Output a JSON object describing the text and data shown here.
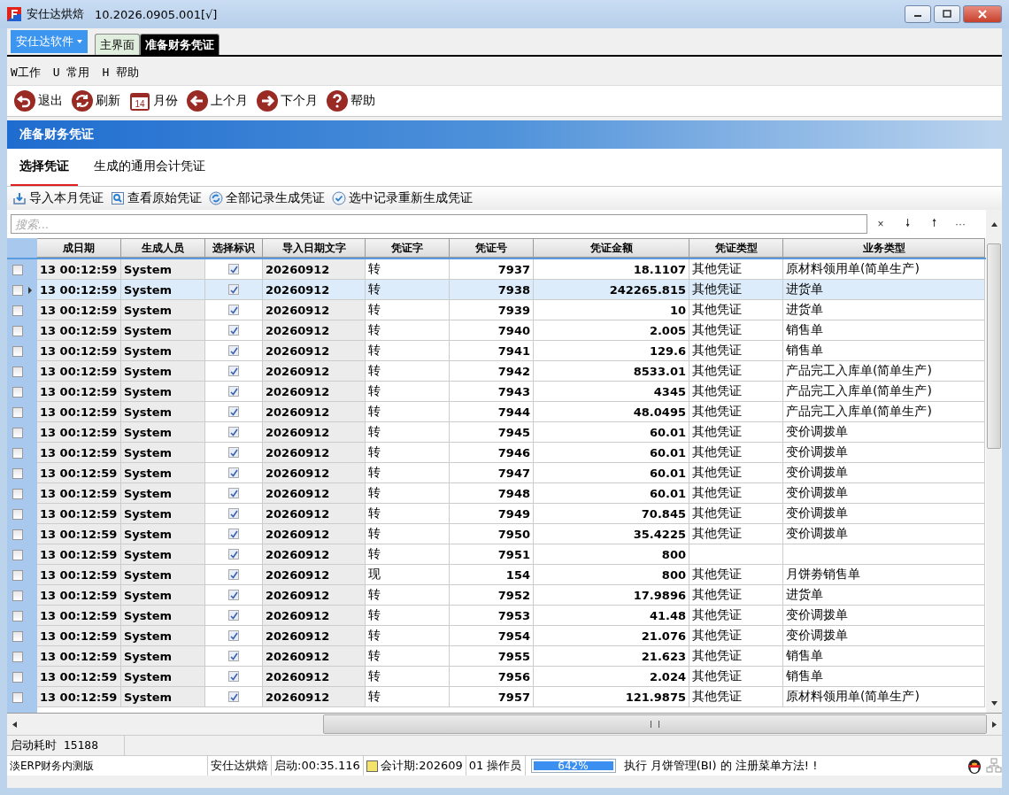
{
  "window": {
    "title": "安仕达烘焙",
    "version": "10.2026.0905.001[√]"
  },
  "app_menu": {
    "label": "安仕达软件"
  },
  "doc_tabs": [
    {
      "label": "主界面",
      "selected": false
    },
    {
      "label": "准备财务凭证",
      "selected": true
    }
  ],
  "menu": [
    "W工作",
    "U 常用",
    "H 帮助"
  ],
  "toolbar": [
    {
      "kind": "exit",
      "label": "退出"
    },
    {
      "kind": "refresh",
      "label": "刷新"
    },
    {
      "kind": "calendar",
      "label": "月份",
      "day": "14"
    },
    {
      "kind": "prev",
      "label": "上个月"
    },
    {
      "kind": "next",
      "label": "下个月"
    },
    {
      "kind": "help",
      "label": "帮助"
    }
  ],
  "panel_title": "准备财务凭证",
  "tabs": [
    {
      "label": "选择凭证",
      "selected": true
    },
    {
      "label": "生成的通用会计凭证",
      "selected": false
    }
  ],
  "actions": [
    {
      "kind": "import",
      "label": "导入本月凭证"
    },
    {
      "kind": "view",
      "label": "查看原始凭证"
    },
    {
      "kind": "cycle",
      "label": "全部记录生成凭证"
    },
    {
      "kind": "check",
      "label": "选中记录重新生成凭证"
    }
  ],
  "search": {
    "placeholder": "搜索...",
    "buttons": [
      "×",
      "🠗",
      "🠕",
      "···"
    ]
  },
  "table": {
    "columns": [
      "成日期",
      "生成人员",
      "选择标识",
      "导入日期文字",
      "凭证字",
      "凭证号",
      "凭证金额",
      "凭证类型",
      "业务类型"
    ],
    "rows": [
      {
        "checked": false,
        "selected": false,
        "date": "13 00:12:59",
        "person": "System",
        "marked": true,
        "import": "20260912",
        "char": "转",
        "no": "7937",
        "amount": "18.1107",
        "type": "其他凭证",
        "business": "原材料领用单(简单生产)"
      },
      {
        "checked": false,
        "selected": true,
        "date": "13 00:12:59",
        "person": "System",
        "marked": true,
        "import": "20260912",
        "char": "转",
        "no": "7938",
        "amount": "242265.815",
        "type": "其他凭证",
        "business": "进货单"
      },
      {
        "checked": false,
        "selected": false,
        "date": "13 00:12:59",
        "person": "System",
        "marked": true,
        "import": "20260912",
        "char": "转",
        "no": "7939",
        "amount": "10",
        "type": "其他凭证",
        "business": "进货单"
      },
      {
        "checked": false,
        "selected": false,
        "date": "13 00:12:59",
        "person": "System",
        "marked": true,
        "import": "20260912",
        "char": "转",
        "no": "7940",
        "amount": "2.005",
        "type": "其他凭证",
        "business": "销售单"
      },
      {
        "checked": false,
        "selected": false,
        "date": "13 00:12:59",
        "person": "System",
        "marked": true,
        "import": "20260912",
        "char": "转",
        "no": "7941",
        "amount": "129.6",
        "type": "其他凭证",
        "business": "销售单"
      },
      {
        "checked": false,
        "selected": false,
        "date": "13 00:12:59",
        "person": "System",
        "marked": true,
        "import": "20260912",
        "char": "转",
        "no": "7942",
        "amount": "8533.01",
        "type": "其他凭证",
        "business": "产品完工入库单(简单生产)"
      },
      {
        "checked": false,
        "selected": false,
        "date": "13 00:12:59",
        "person": "System",
        "marked": true,
        "import": "20260912",
        "char": "转",
        "no": "7943",
        "amount": "4345",
        "type": "其他凭证",
        "business": "产品完工入库单(简单生产)"
      },
      {
        "checked": false,
        "selected": false,
        "date": "13 00:12:59",
        "person": "System",
        "marked": true,
        "import": "20260912",
        "char": "转",
        "no": "7944",
        "amount": "48.0495",
        "type": "其他凭证",
        "business": "产品完工入库单(简单生产)"
      },
      {
        "checked": false,
        "selected": false,
        "date": "13 00:12:59",
        "person": "System",
        "marked": true,
        "import": "20260912",
        "char": "转",
        "no": "7945",
        "amount": "60.01",
        "type": "其他凭证",
        "business": "变价调拨单"
      },
      {
        "checked": false,
        "selected": false,
        "date": "13 00:12:59",
        "person": "System",
        "marked": true,
        "import": "20260912",
        "char": "转",
        "no": "7946",
        "amount": "60.01",
        "type": "其他凭证",
        "business": "变价调拨单"
      },
      {
        "checked": false,
        "selected": false,
        "date": "13 00:12:59",
        "person": "System",
        "marked": true,
        "import": "20260912",
        "char": "转",
        "no": "7947",
        "amount": "60.01",
        "type": "其他凭证",
        "business": "变价调拨单"
      },
      {
        "checked": false,
        "selected": false,
        "date": "13 00:12:59",
        "person": "System",
        "marked": true,
        "import": "20260912",
        "char": "转",
        "no": "7948",
        "amount": "60.01",
        "type": "其他凭证",
        "business": "变价调拨单"
      },
      {
        "checked": false,
        "selected": false,
        "date": "13 00:12:59",
        "person": "System",
        "marked": true,
        "import": "20260912",
        "char": "转",
        "no": "7949",
        "amount": "70.845",
        "type": "其他凭证",
        "business": "变价调拨单"
      },
      {
        "checked": false,
        "selected": false,
        "date": "13 00:12:59",
        "person": "System",
        "marked": true,
        "import": "20260912",
        "char": "转",
        "no": "7950",
        "amount": "35.4225",
        "type": "其他凭证",
        "business": "变价调拨单"
      },
      {
        "checked": false,
        "selected": false,
        "date": "13 00:12:59",
        "person": "System",
        "marked": true,
        "import": "20260912",
        "char": "转",
        "no": "7951",
        "amount": "800"
      },
      {
        "checked": false,
        "selected": false,
        "date": "13 00:12:59",
        "person": "System",
        "marked": true,
        "import": "20260912",
        "char": "现",
        "no": "154",
        "amount": "800",
        "type": "其他凭证",
        "business": "月饼劵销售单"
      },
      {
        "checked": false,
        "selected": false,
        "date": "13 00:12:59",
        "person": "System",
        "marked": true,
        "import": "20260912",
        "char": "转",
        "no": "7952",
        "amount": "17.9896",
        "type": "其他凭证",
        "business": "进货单"
      },
      {
        "checked": false,
        "selected": false,
        "date": "13 00:12:59",
        "person": "System",
        "marked": true,
        "import": "20260912",
        "char": "转",
        "no": "7953",
        "amount": "41.48",
        "type": "其他凭证",
        "business": "变价调拨单"
      },
      {
        "checked": false,
        "selected": false,
        "date": "13 00:12:59",
        "person": "System",
        "marked": true,
        "import": "20260912",
        "char": "转",
        "no": "7954",
        "amount": "21.076",
        "type": "其他凭证",
        "business": "变价调拨单"
      },
      {
        "checked": false,
        "selected": false,
        "date": "13 00:12:59",
        "person": "System",
        "marked": true,
        "import": "20260912",
        "char": "转",
        "no": "7955",
        "amount": "21.623",
        "type": "其他凭证",
        "business": "销售单"
      },
      {
        "checked": false,
        "selected": false,
        "date": "13 00:12:59",
        "person": "System",
        "marked": true,
        "import": "20260912",
        "char": "转",
        "no": "7956",
        "amount": "2.024",
        "type": "其他凭证",
        "business": "销售单"
      },
      {
        "checked": false,
        "selected": false,
        "date": "13 00:12:59",
        "person": "System",
        "marked": true,
        "import": "20260912",
        "char": "转",
        "no": "7957",
        "amount": "121.9875",
        "type": "其他凭证",
        "business": "原材料领用单(简单生产)"
      }
    ]
  },
  "startup_bar": "启动耗时 15188 ",
  "status_bar": {
    "edition": "淡ERP财务内测版",
    "company": "安仕达烘焙",
    "startup": "启动:00:35.116",
    "period": "会计期:202609",
    "operator": "01 操作员",
    "progress": {
      "level": 1,
      "reading": "642%"
    },
    "message": "执行 月饼管理(BI) 的 注册菜单方法! !"
  }
}
